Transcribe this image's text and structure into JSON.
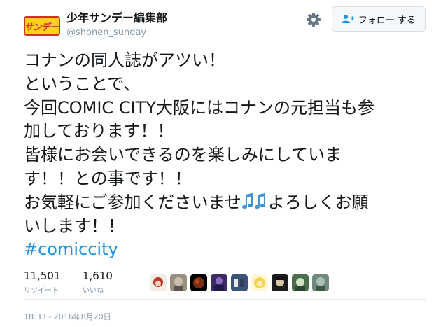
{
  "account": {
    "name": "少年サンデー編集部",
    "handle": "@shonen_sunday",
    "logo_text": "サンデー"
  },
  "follow_button": {
    "label": "フォロー する"
  },
  "tweet": {
    "lines": [
      "コナンの同人誌がアツい！",
      "ということで、",
      "今回COMIC CITY大阪にはコナンの元担当も参",
      "加しております！！",
      "皆様にお会いできるのを楽しみにしていま",
      "す！！との事です！！"
    ],
    "line7_before": "お気軽にご参加くださいませ",
    "line7_after": "よろしくお願",
    "line8": "いします！！",
    "hashtag": "#comiccity"
  },
  "stats": {
    "retweets": {
      "count": "11,501",
      "label": "リツイート"
    },
    "likes": {
      "count": "1,610",
      "label": "いいね"
    }
  },
  "timestamp": "18:33 - 2016年8月20日",
  "icons": {
    "gear": "gear-icon",
    "follow": "add-user-icon",
    "notes": "musical-notes-icon"
  },
  "colors": {
    "link": "#1b95e0",
    "text": "#14171a",
    "muted": "#8899a6",
    "logo_bg": "#ffd21a",
    "logo_border": "#d0321e",
    "notes": "#3b94d9"
  }
}
